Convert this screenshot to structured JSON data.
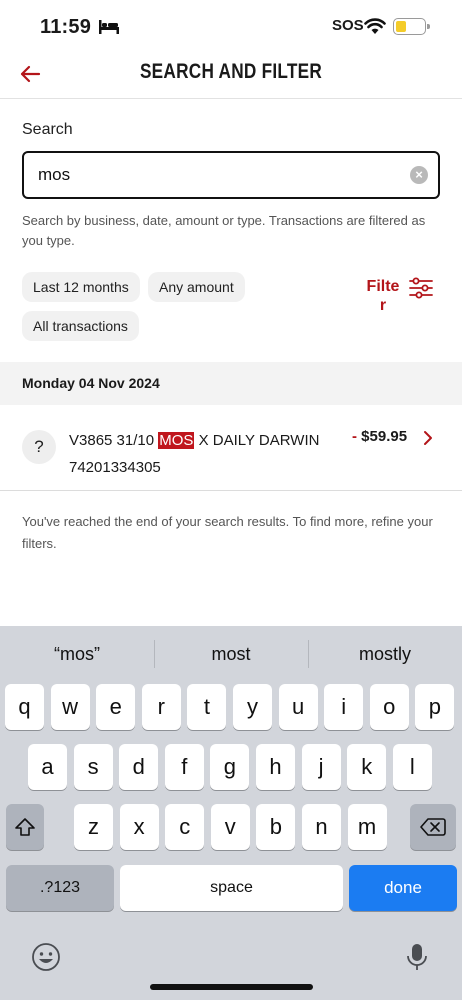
{
  "status_bar": {
    "time": "11:59",
    "sos": "SOS"
  },
  "header": {
    "title": "SEARCH AND FILTER"
  },
  "search": {
    "label": "Search",
    "value": "mos",
    "helper": "Search by business, date, amount or type. Transactions are filtered as you type."
  },
  "filters": {
    "chips": [
      "Last 12 months",
      "Any amount",
      "All transactions"
    ],
    "filter_label": "Filter"
  },
  "results": {
    "date_header": "Monday 04 Nov 2024",
    "transactions": [
      {
        "icon": "?",
        "desc_before": "V3865 31/10 ",
        "desc_highlight": "MOS",
        "desc_after": " X DAILY DARWIN 74201334305",
        "sign": "- ",
        "amount": "$59.95"
      }
    ],
    "end_message": "You've reached the end of your search results. To find more, refine your filters."
  },
  "keyboard": {
    "suggestions": [
      "“mos”",
      "most",
      "mostly"
    ],
    "row1": [
      "q",
      "w",
      "e",
      "r",
      "t",
      "y",
      "u",
      "i",
      "o",
      "p"
    ],
    "row2": [
      "a",
      "s",
      "d",
      "f",
      "g",
      "h",
      "j",
      "k",
      "l"
    ],
    "row3": [
      "z",
      "x",
      "c",
      "v",
      "b",
      "n",
      "m"
    ],
    "numbers_key": ".?123",
    "space_key": "space",
    "done_key": "done"
  },
  "colors": {
    "brand_red": "#b3151a",
    "done_blue": "#1b7cf2"
  }
}
